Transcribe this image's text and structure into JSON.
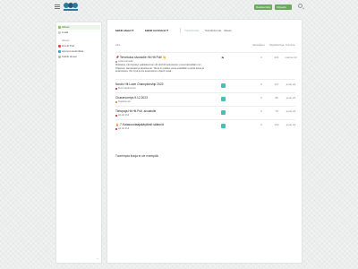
{
  "header": {
    "register_label": "Rekisteröidy",
    "login_label": "Kirjaudu"
  },
  "sidebar": {
    "items": [
      {
        "label": "Aiheet",
        "active": true
      },
      {
        "label": "Lisää"
      }
    ],
    "categories_heading": "Alueet",
    "categories": [
      {
        "label": "Hit Hit Pull",
        "color": "#d94f4f"
      },
      {
        "label": "Ajoneuvotekniikka",
        "color": "#38a3d8"
      },
      {
        "label": "Kaikki alueet",
        "color": "#888888"
      }
    ]
  },
  "nav": {
    "categories_dropdown": "kaikki alueet",
    "tags_dropdown": "kaikki tunnisteet",
    "tabs": [
      "Tuoreimmat",
      "Suosituimmat",
      "Alueet"
    ]
  },
  "table": {
    "columns": [
      "Aihe",
      "Vastaukset",
      "Näyttökertoja",
      "Toiminta"
    ],
    "rows": [
      {
        "title": "📌 Tervetuloa sivustolle Hit Hit Pull! 👋",
        "category": "Uusia tarinoita",
        "category_color": "#aaaaaa",
        "excerpt": "Moikassa, olet löytänyt paikkakunnan Hit Hit Pull keskustelun, jossa käsitellään mm. Ohjelmat, Harrastajat ja tapahtumat. Tämä on paikka, jossa esitellään uusinta tietoa ja keskustelua. Ole hyvä ja lue keskustelun ohjeet! Lisää...",
        "pinned": true,
        "replies": "0",
        "views": "221",
        "activity": "marras 22"
      },
      {
        "title": "Nordic Hit Lowe Championship 2023",
        "category": "Muut tapahtumat",
        "category_color": "#d94f4f",
        "replies": "0",
        "views": "147",
        "activity": "joulu 22"
      },
      {
        "title": "Chasercomps 9.12.2023",
        "category": "Tapahtumat",
        "category_color": "#e09a2c",
        "replies": "0",
        "views": "88",
        "activity": "joulu 22"
      },
      {
        "title": "Tietopaja Hit Hit Pull -sivustolle",
        "category": "Hit Hit Pull",
        "category_color": "#d94f4f",
        "replies": "0",
        "views": "78",
        "activity": "joulu 22"
      },
      {
        "title": "🔒 7-Kalasuuntaajakäytäntö säännöt",
        "category": "Hit Hit Pull",
        "category_color": "#d94f4f",
        "replies": "0",
        "views": "102",
        "activity": "joulu 22"
      }
    ],
    "footer_note": "Tuoreimpia listoja ei ole enempää."
  }
}
